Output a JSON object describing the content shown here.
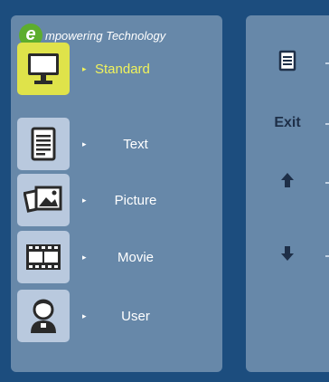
{
  "brand": {
    "logo_letter": "e",
    "text": "mpowering Technology",
    "logo_color": "#5dad2e"
  },
  "modes": [
    {
      "label": "Standard",
      "icon": "monitor-icon",
      "selected": true
    },
    {
      "label": "Text",
      "icon": "document-icon",
      "selected": false
    },
    {
      "label": "Picture",
      "icon": "pictures-icon",
      "selected": false
    },
    {
      "label": "Movie",
      "icon": "film-icon",
      "selected": false
    },
    {
      "label": "User",
      "icon": "user-icon",
      "selected": false
    }
  ],
  "arrow_glyph": "▸",
  "controls": {
    "menu_icon": "menu-icon",
    "exit_label": "Exit",
    "up_icon": "up-arrow-icon",
    "down_icon": "down-arrow-icon"
  },
  "colors": {
    "background": "#1c4d7e",
    "panel": "#6788a9",
    "icon_box": "#b9c9de",
    "selected_box": "#dfe34a",
    "selected_text": "#f1f35c"
  }
}
